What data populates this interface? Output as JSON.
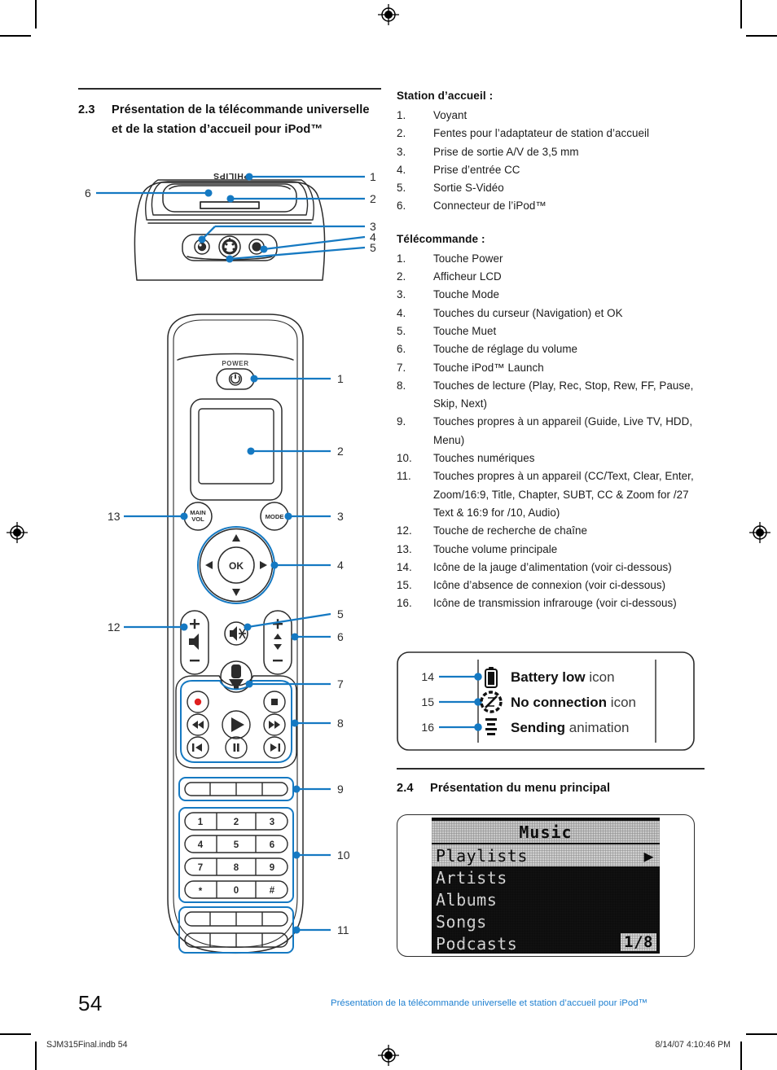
{
  "document": {
    "page_number": "54",
    "footer_text": "Présentation de la télécommande universelle et station d’accueil pour iPod™",
    "imprint_left": "SJM315Final.indb   54",
    "imprint_right": "8/14/07   4:10:46 PM"
  },
  "colors": {
    "accent_blue": "#1579c2",
    "footer_blue": "#1d7fd0",
    "text": "#1a1a1a",
    "record_red": "#e02020"
  },
  "section_23": {
    "number": "2.3",
    "title": "Présentation de la télécommande universelle et de la station d’accueil pour iPod™"
  },
  "section_24": {
    "number": "2.4",
    "title": "Présentation du menu principal"
  },
  "dock_list": {
    "heading": "Station d’accueil :",
    "items": [
      {
        "n": "1.",
        "text": "Voyant"
      },
      {
        "n": "2.",
        "text": "Fentes pour l’adaptateur de station d’accueil"
      },
      {
        "n": "3.",
        "text": "Prise de sortie A/V de 3,5 mm"
      },
      {
        "n": "4.",
        "text": "Prise d’entrée CC"
      },
      {
        "n": "5.",
        "text": "Sortie S-Vidéo"
      },
      {
        "n": "6.",
        "text": "Connecteur de l’iPod™"
      }
    ]
  },
  "remote_list": {
    "heading": "Télécommande :",
    "items": [
      {
        "n": "1.",
        "text": "Touche Power"
      },
      {
        "n": "2.",
        "text": "Afficheur LCD"
      },
      {
        "n": "3.",
        "text": "Touche Mode"
      },
      {
        "n": "4.",
        "text": "Touches du curseur (Navigation) et OK"
      },
      {
        "n": "5.",
        "text": "Touche Muet"
      },
      {
        "n": "6.",
        "text": "Touche de réglage du volume"
      },
      {
        "n": "7.",
        "text": "Touche iPod™ Launch"
      },
      {
        "n": "8.",
        "text": "Touches de lecture (Play, Rec, Stop, Rew, FF, Pause, Skip, Next)"
      },
      {
        "n": "9.",
        "text": "Touches propres à un appareil (Guide, Live TV, HDD, Menu)"
      },
      {
        "n": "10.",
        "text": "Touches numériques"
      },
      {
        "n": "11.",
        "text": "Touches propres à un appareil (CC/Text, Clear, Enter, Zoom/16:9, Title, Chapter, SUBT, CC & Zoom for /27 Text & 16:9 for /10, Audio)"
      },
      {
        "n": "12.",
        "text": "Touche de recherche de chaîne"
      },
      {
        "n": "13.",
        "text": "Touche volume principale"
      },
      {
        "n": "14.",
        "text": "Icône de la jauge d’alimentation (voir ci-dessous)"
      },
      {
        "n": "15.",
        "text": "Icône d’absence de connexion (voir ci-dessous)"
      },
      {
        "n": "16.",
        "text": "Icône de transmission infrarouge (voir ci-dessous)"
      }
    ]
  },
  "icon_legend": {
    "rows": [
      {
        "callout": "14",
        "icon": "battery-low-icon",
        "bold": "Battery low",
        "rest": " icon"
      },
      {
        "callout": "15",
        "icon": "no-connection-icon",
        "bold": "No connection",
        "rest": " icon"
      },
      {
        "callout": "16",
        "icon": "sending-animation-icon",
        "bold": "Sending",
        "rest": " animation"
      }
    ]
  },
  "dock_figure": {
    "brand": "PHILIPS",
    "callouts": [
      "1",
      "2",
      "3",
      "4",
      "5",
      "6"
    ]
  },
  "remote_figure": {
    "power_label": "POWER",
    "main_vol_label_line1": "MAIN",
    "main_vol_label_line2": "VOL",
    "mode_label": "MODE",
    "ok_label": "OK",
    "keypad": [
      "1",
      "2",
      "3",
      "4",
      "5",
      "6",
      "7",
      "8",
      "9",
      "*",
      "0",
      "#"
    ],
    "callouts": [
      "1",
      "2",
      "3",
      "4",
      "5",
      "6",
      "7",
      "8",
      "9",
      "10",
      "11",
      "12",
      "13"
    ]
  },
  "lcd_menu": {
    "title": "Music",
    "items": [
      "Playlists",
      "Artists",
      "Albums",
      "Songs",
      "Podcasts"
    ],
    "selected_index": 0,
    "page_indicator": "1/8",
    "arrow": "▶"
  }
}
